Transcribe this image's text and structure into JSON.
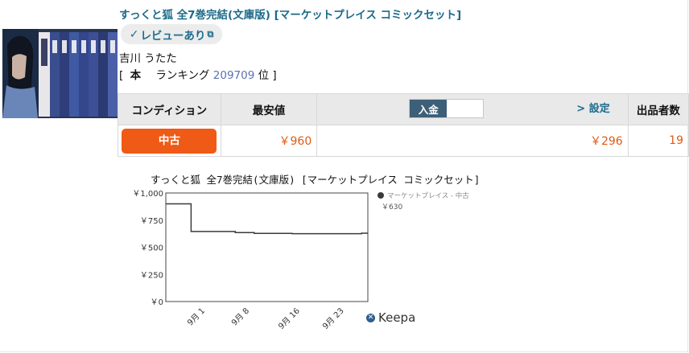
{
  "product": {
    "title": "すっくと狐 全7巻完結(文庫版) [マーケットプレイス コミックセット]",
    "review_badge": "レビューあり",
    "author": "吉川 うたた",
    "ranking_prefix": "[",
    "ranking_label": "本",
    "ranking_text": "ランキング",
    "ranking_number": "209709",
    "ranking_suffix": "位 ]"
  },
  "offers_table": {
    "headers": {
      "condition": "コンディション",
      "lowest_price": "最安値",
      "settings": "> 設定",
      "sellers": "出品者数"
    },
    "toggle_label": "入金",
    "row": {
      "condition": "中古",
      "price": "￥960",
      "deposit": "￥296",
      "seller_count": "19"
    }
  },
  "keepa_label": "Keepa",
  "chart_data": {
    "type": "line",
    "title": "すっくと狐 全7巻完結(文庫版) [マーケットプレイス コミックセット]",
    "x_tick_labels": [
      "9月 1",
      "9月 8",
      "9月 16",
      "9月 23"
    ],
    "y_tick_labels": [
      "￥1,000",
      "￥750",
      "￥500",
      "￥250",
      "￥0"
    ],
    "ylim": [
      0,
      1000
    ],
    "grid": true,
    "legend_position": "right",
    "series": [
      {
        "name": "マーケットプレイス - 中古",
        "legend_value": "￥630",
        "color": "#3a3a3a",
        "points": [
          {
            "x": "8/26",
            "y": 900
          },
          {
            "x": "8/30",
            "y": 900
          },
          {
            "x": "8/30",
            "y": 645
          },
          {
            "x": "9/6",
            "y": 645
          },
          {
            "x": "9/6",
            "y": 635
          },
          {
            "x": "9/9",
            "y": 635
          },
          {
            "x": "9/9",
            "y": 628
          },
          {
            "x": "9/15",
            "y": 628
          },
          {
            "x": "9/15",
            "y": 625
          },
          {
            "x": "9/26",
            "y": 625
          },
          {
            "x": "9/26",
            "y": 630
          },
          {
            "x": "9/27",
            "y": 630
          }
        ]
      }
    ]
  }
}
